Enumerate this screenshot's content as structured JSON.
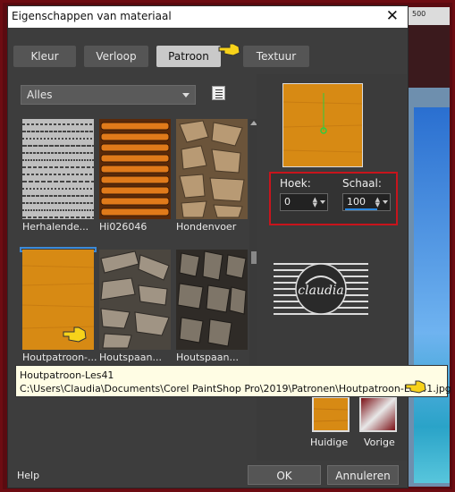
{
  "background": {
    "ruler_label": "500"
  },
  "dialog": {
    "title": "Eigenschappen van materiaal",
    "close_glyph": "✕",
    "tabs": [
      "Kleur",
      "Verloop",
      "Patroon",
      "Textuur"
    ],
    "active_tab": "Patroon",
    "category_value": "Alles",
    "patterns": [
      {
        "label": "Herhalende...",
        "icon": "text-pattern-thumb"
      },
      {
        "label": "Hi026046",
        "icon": "orange-sticks-thumb"
      },
      {
        "label": "Hondenvoer",
        "icon": "brown-stones-thumb"
      },
      {
        "label": "Houtpatroon-...",
        "icon": "orange-wood-thumb",
        "selected": true
      },
      {
        "label": "Houtspaan...",
        "icon": "wood-chips-thumb"
      },
      {
        "label": "Houtspaan...",
        "icon": "dark-wood-chips-thumb"
      }
    ],
    "angle_label": "Hoek:",
    "angle_value": "0",
    "scale_label": "Schaal:",
    "scale_value": "100",
    "watermark_text": "claudia",
    "tooltip": {
      "name": "Houtpatroon-Les41",
      "path": "C:\\Users\\Claudia\\Documents\\Corel PaintShop Pro\\2019\\Patronen\\Houtpatroon-Les41.jpg"
    },
    "plus_glyph": "+",
    "current_label": "Huidige",
    "previous_label": "Vorige",
    "help_label": "Help",
    "ok_label": "OK",
    "cancel_label": "Annuleren"
  },
  "colors": {
    "accent": "#3c8ad8",
    "highlight_border": "#c8141c",
    "wood": "#d78a14"
  }
}
